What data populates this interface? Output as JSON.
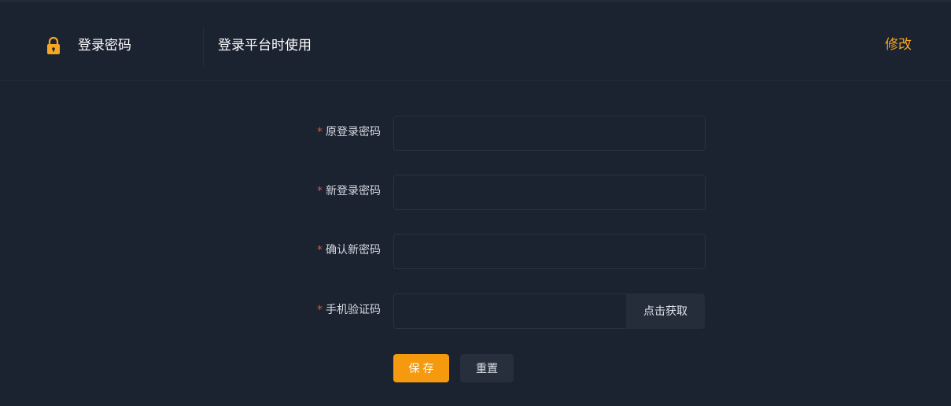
{
  "header": {
    "icon": "lock-icon",
    "title": "登录密码",
    "description": "登录平台时使用",
    "action_label": "修改",
    "accent_color": "#f5a623"
  },
  "form": {
    "required_mark": "*",
    "fields": [
      {
        "label": "原登录密码",
        "value": "",
        "placeholder": ""
      },
      {
        "label": "新登录密码",
        "value": "",
        "placeholder": ""
      },
      {
        "label": "确认新密码",
        "value": "",
        "placeholder": ""
      },
      {
        "label": "手机验证码",
        "value": "",
        "placeholder": ""
      }
    ],
    "get_code_label": "点击获取",
    "save_label": "保存",
    "reset_label": "重置"
  },
  "colors": {
    "background": "#1b2230",
    "primary_button": "#f59a0e",
    "required_star": "#e0563b"
  }
}
